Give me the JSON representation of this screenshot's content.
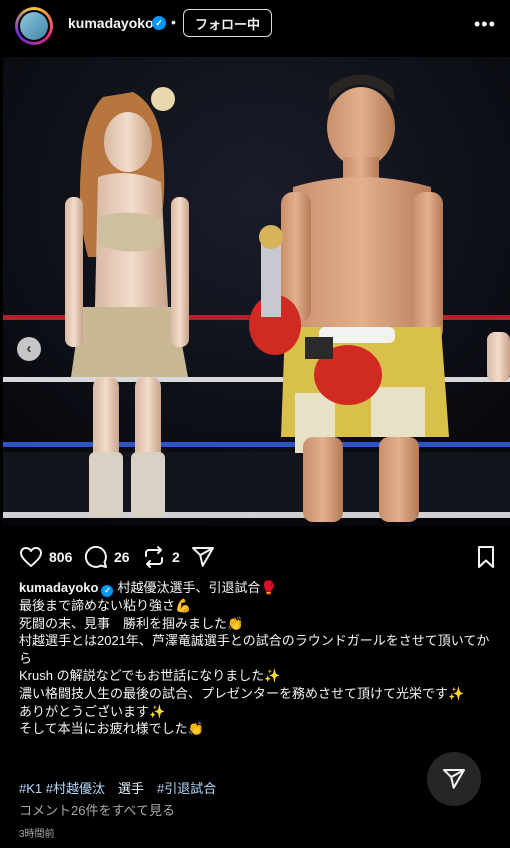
{
  "header": {
    "username": "kumadayoko",
    "separator": "•",
    "follow_label": "フォロー中",
    "more_label": "•••"
  },
  "media": {
    "carousel_index": 3,
    "carousel_total": 3
  },
  "actions": {
    "likes": "806",
    "comments": "26",
    "reposts": "2"
  },
  "caption": {
    "username": "kumadayoko",
    "lines": [
      "村越優汰選手、引退試合🥊",
      "最後まで諦めない粘り強さ💪",
      "死闘の末、見事　勝利を掴みました👏",
      "村越選手とは2021年、芦澤竜誠選手との試合のラウンドガールをさせて頂いてから",
      "Krush の解説などでもお世話になりました✨",
      "濃い格闘技人生の最後の試合、プレゼンターを務めさせて頂けて光栄です✨",
      "ありがとうございます✨",
      "そして本当にお疲れ様でした👏"
    ]
  },
  "tags": {
    "tag1": "#K1",
    "tag2": "#村越優汰",
    "tag3": "選手",
    "tag4": "#引退試合"
  },
  "comments_link": "コメント26件をすべて見る",
  "timestamp": "3時間前",
  "colors": {
    "verified": "#0095f6",
    "background": "#000000",
    "secondary_text": "#a8a8a8"
  }
}
